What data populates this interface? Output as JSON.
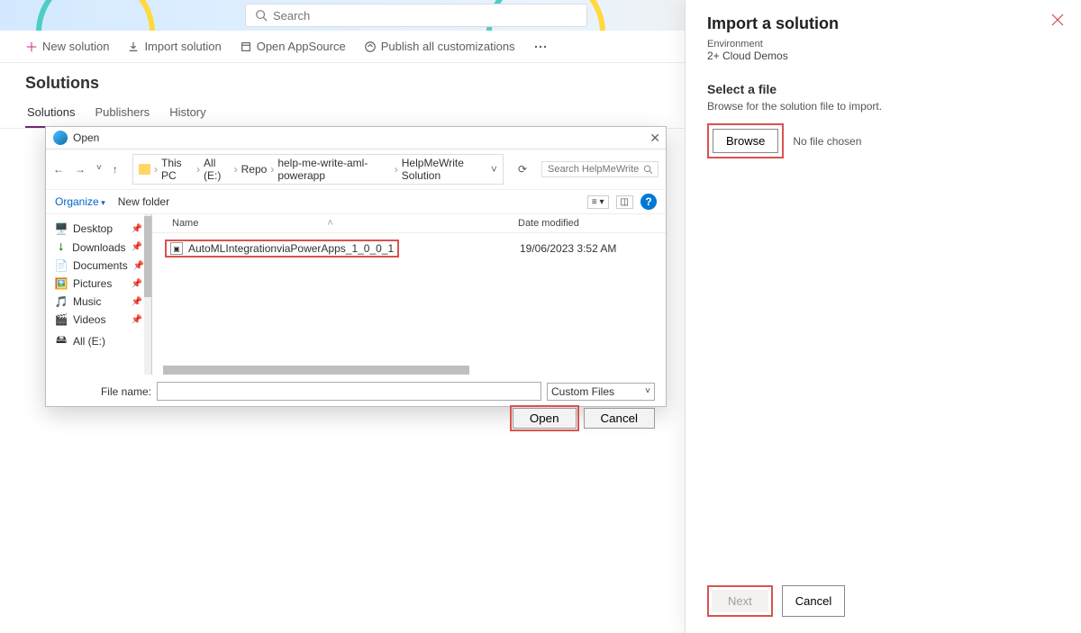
{
  "search": {
    "placeholder": "Search"
  },
  "cmdbar": {
    "new": "New solution",
    "import": "Import solution",
    "appsource": "Open AppSource",
    "publish": "Publish all customizations"
  },
  "page": {
    "title": "Solutions"
  },
  "tabs": {
    "solutions": "Solutions",
    "publishers": "Publishers",
    "history": "History"
  },
  "dialog": {
    "title": "Open",
    "breadcrumb": [
      "This PC",
      "All (E:)",
      "Repo",
      "help-me-write-aml-powerapp",
      "HelpMeWrite Solution"
    ],
    "search_placeholder": "Search HelpMeWrite Solution",
    "organize": "Organize",
    "new_folder": "New folder",
    "col_name": "Name",
    "col_date": "Date modified",
    "sidebar": {
      "desktop": "Desktop",
      "downloads": "Downloads",
      "documents": "Documents",
      "pictures": "Pictures",
      "music": "Music",
      "videos": "Videos",
      "all_e": "All (E:)"
    },
    "file": {
      "name": "AutoMLIntegrationviaPowerApps_1_0_0_1",
      "date": "19/06/2023 3:52 AM"
    },
    "filename_label": "File name:",
    "filter": "Custom Files",
    "open": "Open",
    "cancel": "Cancel"
  },
  "panel": {
    "title": "Import a solution",
    "env_label": "Environment",
    "env_value": "2+ Cloud Demos",
    "section_title": "Select a file",
    "section_desc": "Browse for the solution file to import.",
    "browse": "Browse",
    "no_file": "No file chosen",
    "next": "Next",
    "cancel": "Cancel"
  }
}
